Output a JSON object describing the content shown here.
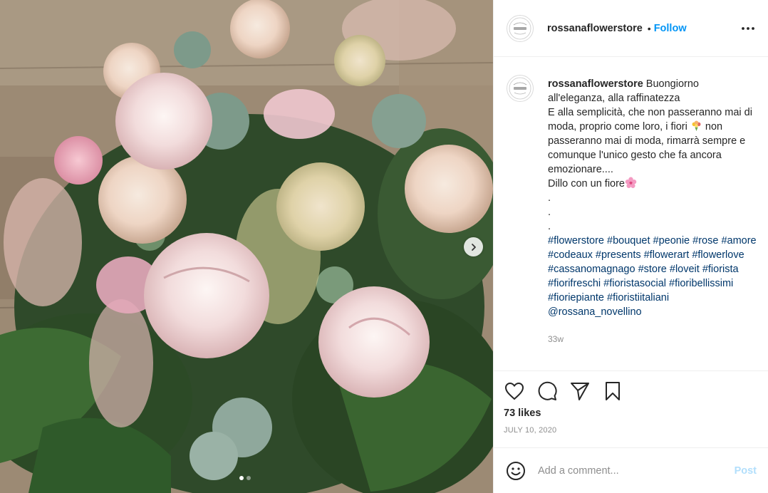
{
  "media": {
    "alt_icon": "flower-bouquet-photo",
    "carousel": {
      "count": 2,
      "active_index": 0
    }
  },
  "header": {
    "username": "rossanaflowerstore",
    "separator": "•",
    "follow_label": "Follow",
    "avatar_text": [
      "Rossana",
      "flower store"
    ]
  },
  "caption": {
    "username": "rossanaflowerstore",
    "text_part1": " Buongiorno all'eleganza, alla raffinatezza\nE alla semplicità, che non passeranno mai di moda, proprio come loro, i fiori ",
    "text_part2": " non passeranno mai di moda, rimarrà sempre e comunque l'unico gesto che fa ancora emozionare....\nDillo con un fiore",
    "dots": ".\n.\n.",
    "hashtags": "#flowerstore #bouquet #peonie #rose #amore #codeaux #presents #flowerart #flowerlove #cassanomagnago #store #loveit #fiorista #fiorifreschi #fioristasocial #fioribellissimi #fioriepiante #fioristiitaliani",
    "mention": "@rossana_novellino",
    "time_ago": "33w"
  },
  "actions": {
    "likes": "73 likes",
    "date": "JULY 10, 2020"
  },
  "comment_box": {
    "placeholder": "Add a comment...",
    "post_label": "Post"
  },
  "colors": {
    "follow_blue": "#0095f6",
    "post_disabled": "#b2dffc",
    "hashtag": "#00376b",
    "muted": "#8e8e8e",
    "divider": "#efefef"
  }
}
